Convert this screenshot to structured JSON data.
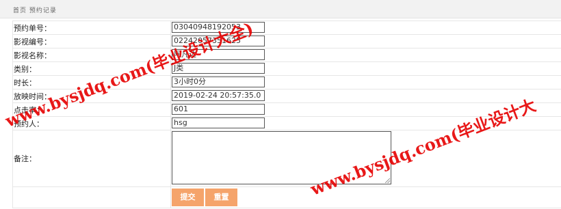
{
  "breadcrumb": "首页 预约记录",
  "form": {
    "rows": [
      {
        "label": "预约单号：",
        "value": "03040948192053"
      },
      {
        "label": "影视编号：",
        "value": "02242057351625"
      },
      {
        "label": "影视名称：",
        "value": "阿凡达"
      },
      {
        "label": "类别：",
        "value": "J类"
      },
      {
        "label": "时长：",
        "value": "3小时0分"
      },
      {
        "label": "放映时间：",
        "value": "2019-02-24 20:57:35.0"
      },
      {
        "label": "点击率：",
        "value": "601"
      },
      {
        "label": "预约人：",
        "value": "hsg"
      }
    ],
    "remark_label": "备注：",
    "remark_value": "",
    "submit_label": "提交",
    "reset_label": "重置"
  },
  "watermark": {
    "text1": "www.bysjdq.com(毕业设计大全)",
    "text2": "www.bysjdq.com(毕业设计大"
  },
  "colors": {
    "button": "#f5a46b",
    "watermark": "#e60000"
  }
}
